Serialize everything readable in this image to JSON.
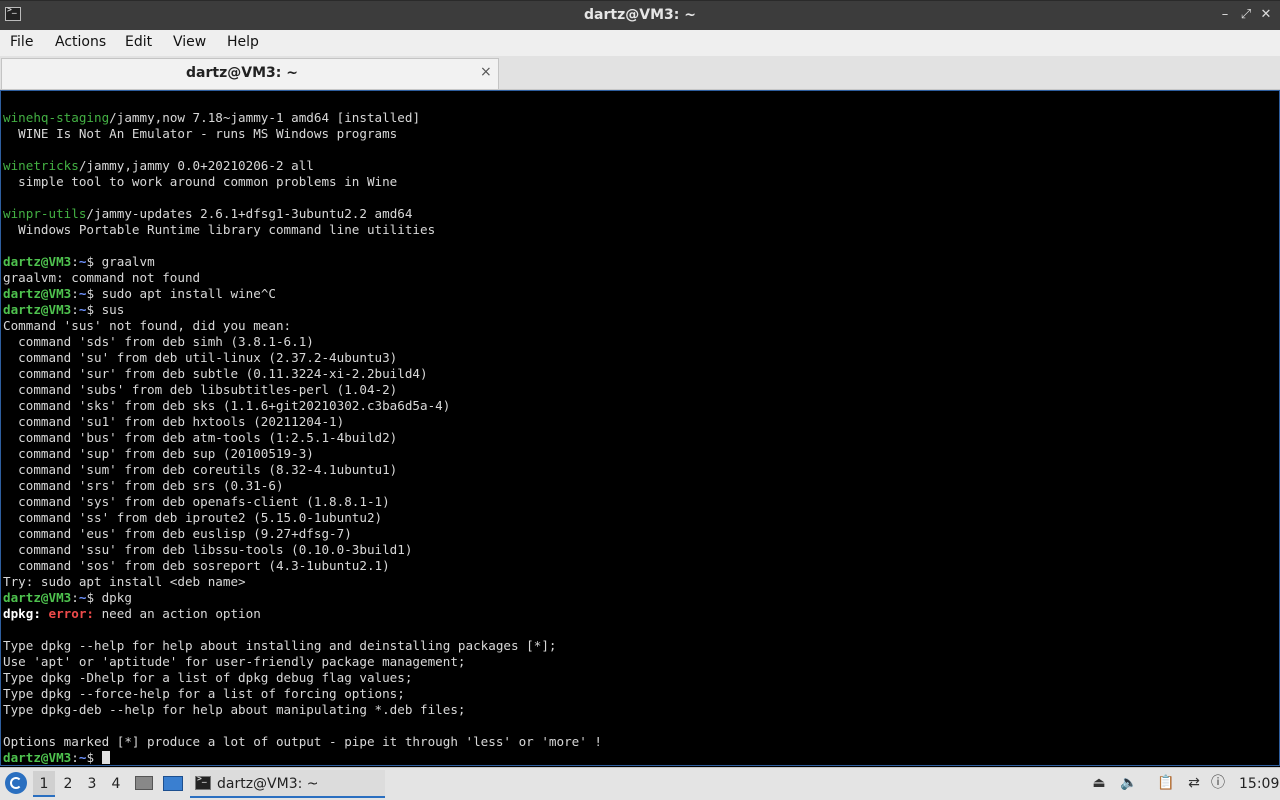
{
  "window": {
    "title": "dartz@VM3: ~"
  },
  "menu": [
    "File",
    "Actions",
    "Edit",
    "View",
    "Help"
  ],
  "tab": {
    "title": "dartz@VM3: ~",
    "close": "×"
  },
  "terminal": {
    "lines": [
      [
        {
          "t": "winehq-staging",
          "c": "g"
        },
        {
          "t": "/jammy,now 7.18~jammy-1 amd64 [installed]"
        }
      ],
      [
        {
          "t": "  WINE Is Not An Emulator - runs MS Windows programs"
        }
      ],
      [],
      [
        {
          "t": "winetricks",
          "c": "g"
        },
        {
          "t": "/jammy,jammy 0.0+20210206-2 all"
        }
      ],
      [
        {
          "t": "  simple tool to work around common problems in Wine"
        }
      ],
      [],
      [
        {
          "t": "winpr-utils",
          "c": "g"
        },
        {
          "t": "/jammy-updates 2.6.1+dfsg1-3ubuntu2.2 amd64"
        }
      ],
      [
        {
          "t": "  Windows Portable Runtime library command line utilities"
        }
      ],
      [],
      [
        {
          "t": "dartz@VM3",
          "c": "p"
        },
        {
          "t": ":"
        },
        {
          "t": "~",
          "c": "b"
        },
        {
          "t": "$ graalvm"
        }
      ],
      [
        {
          "t": "graalvm: command not found"
        }
      ],
      [
        {
          "t": "dartz@VM3",
          "c": "p"
        },
        {
          "t": ":"
        },
        {
          "t": "~",
          "c": "b"
        },
        {
          "t": "$ sudo apt install wine^C"
        }
      ],
      [
        {
          "t": "dartz@VM3",
          "c": "p"
        },
        {
          "t": ":"
        },
        {
          "t": "~",
          "c": "b"
        },
        {
          "t": "$ sus"
        }
      ],
      [
        {
          "t": "Command 'sus' not found, did you mean:"
        }
      ],
      [
        {
          "t": "  command 'sds' from deb simh (3.8.1-6.1)"
        }
      ],
      [
        {
          "t": "  command 'su' from deb util-linux (2.37.2-4ubuntu3)"
        }
      ],
      [
        {
          "t": "  command 'sur' from deb subtle (0.11.3224-xi-2.2build4)"
        }
      ],
      [
        {
          "t": "  command 'subs' from deb libsubtitles-perl (1.04-2)"
        }
      ],
      [
        {
          "t": "  command 'sks' from deb sks (1.1.6+git20210302.c3ba6d5a-4)"
        }
      ],
      [
        {
          "t": "  command 'su1' from deb hxtools (20211204-1)"
        }
      ],
      [
        {
          "t": "  command 'bus' from deb atm-tools (1:2.5.1-4build2)"
        }
      ],
      [
        {
          "t": "  command 'sup' from deb sup (20100519-3)"
        }
      ],
      [
        {
          "t": "  command 'sum' from deb coreutils (8.32-4.1ubuntu1)"
        }
      ],
      [
        {
          "t": "  command 'srs' from deb srs (0.31-6)"
        }
      ],
      [
        {
          "t": "  command 'sys' from deb openafs-client (1.8.8.1-1)"
        }
      ],
      [
        {
          "t": "  command 'ss' from deb iproute2 (5.15.0-1ubuntu2)"
        }
      ],
      [
        {
          "t": "  command 'eus' from deb euslisp (9.27+dfsg-7)"
        }
      ],
      [
        {
          "t": "  command 'ssu' from deb libssu-tools (0.10.0-3build1)"
        }
      ],
      [
        {
          "t": "  command 'sos' from deb sosreport (4.3-1ubuntu2.1)"
        }
      ],
      [
        {
          "t": "Try: sudo apt install <deb name>"
        }
      ],
      [
        {
          "t": "dartz@VM3",
          "c": "p"
        },
        {
          "t": ":"
        },
        {
          "t": "~",
          "c": "b"
        },
        {
          "t": "$ dpkg"
        }
      ],
      [
        {
          "t": "dpkg: ",
          "c": "w"
        },
        {
          "t": "error:",
          "c": "r"
        },
        {
          "t": " need an action option"
        }
      ],
      [],
      [
        {
          "t": "Type dpkg --help for help about installing and deinstalling packages [*];"
        }
      ],
      [
        {
          "t": "Use 'apt' or 'aptitude' for user-friendly package management;"
        }
      ],
      [
        {
          "t": "Type dpkg -Dhelp for a list of dpkg debug flag values;"
        }
      ],
      [
        {
          "t": "Type dpkg --force-help for a list of forcing options;"
        }
      ],
      [
        {
          "t": "Type dpkg-deb --help for help about manipulating *.deb files;"
        }
      ],
      [],
      [
        {
          "t": "Options marked [*] produce a lot of output - pipe it through 'less' or 'more' !"
        }
      ],
      [
        {
          "t": "dartz@VM3",
          "c": "p"
        },
        {
          "t": ":"
        },
        {
          "t": "~",
          "c": "b"
        },
        {
          "t": "$ "
        }
      ]
    ]
  },
  "taskbar": {
    "workspaces": [
      "1",
      "2",
      "3",
      "4"
    ],
    "active_workspace": "1",
    "task_label": "dartz@VM3: ~",
    "clock": "15:09"
  },
  "colors": {
    "titlebar": "#3c3c3c",
    "terminal_bg": "#000000",
    "prompt_user": "#4ec24e",
    "prompt_path": "#6f93ff",
    "package_name": "#43b043",
    "error": "#ee4b4b",
    "accent": "#2a6fc0"
  }
}
